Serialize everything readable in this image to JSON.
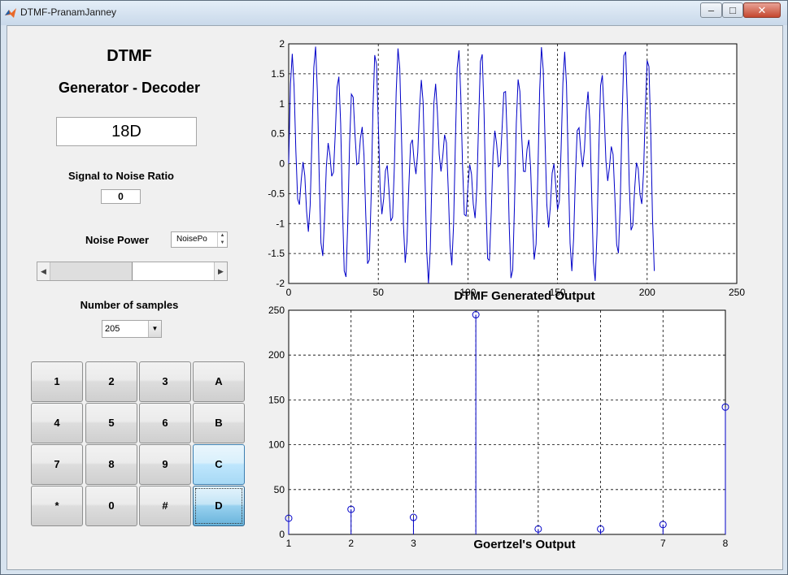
{
  "window": {
    "title": "DTMF-PranamJanney",
    "minimize_glyph": "–",
    "maximize_glyph": "□",
    "close_glyph": "✕"
  },
  "panel": {
    "heading_line1": "DTMF",
    "heading_line2": "Generator - Decoder",
    "display_value": "18D",
    "snr_label": "Signal to Noise Ratio",
    "snr_value": "0",
    "noise_power_label": "Noise Power",
    "noise_power_value": "NoisePo",
    "num_samples_label": "Number of samples",
    "num_samples_value": "205"
  },
  "keypad": {
    "keys": [
      {
        "label": "1"
      },
      {
        "label": "2"
      },
      {
        "label": "3"
      },
      {
        "label": "A"
      },
      {
        "label": "4"
      },
      {
        "label": "5"
      },
      {
        "label": "6"
      },
      {
        "label": "B"
      },
      {
        "label": "7"
      },
      {
        "label": "8"
      },
      {
        "label": "9"
      },
      {
        "label": "C"
      },
      {
        "label": "*"
      },
      {
        "label": "0"
      },
      {
        "label": "#"
      },
      {
        "label": "D"
      }
    ],
    "hovered_key": "C",
    "pressed_key": "D"
  },
  "chart_data": [
    {
      "type": "line",
      "title": "DTMF Generated Output",
      "xlabel": "",
      "ylabel": "",
      "xlim": [
        0,
        250
      ],
      "ylim": [
        -2,
        2
      ],
      "xticks": [
        0,
        50,
        100,
        150,
        200,
        250
      ],
      "yticks": [
        -2,
        -1.5,
        -1,
        -0.5,
        0,
        0.5,
        1,
        1.5,
        2
      ],
      "grid": true,
      "line_color": "#0000c8",
      "series": [
        {
          "samples": 205,
          "components": [
            {
              "amplitude": 1,
              "cycles_per_sample": 0.0865
            },
            {
              "amplitude": 1,
              "cycles_per_sample": 0.1507
            }
          ]
        }
      ]
    },
    {
      "type": "stem",
      "title": "Goertzel's Output",
      "xlabel": "",
      "ylabel": "",
      "xlim": [
        1,
        8
      ],
      "ylim": [
        0,
        250
      ],
      "xticks": [
        1,
        2,
        3,
        7,
        8
      ],
      "yticks": [
        0,
        50,
        100,
        150,
        200,
        250
      ],
      "grid": true,
      "x": [
        1,
        2,
        3,
        4,
        5,
        6,
        7,
        8
      ],
      "values": [
        18,
        28,
        19,
        245,
        6,
        6,
        11,
        142
      ],
      "line_color": "#0000c8"
    }
  ]
}
